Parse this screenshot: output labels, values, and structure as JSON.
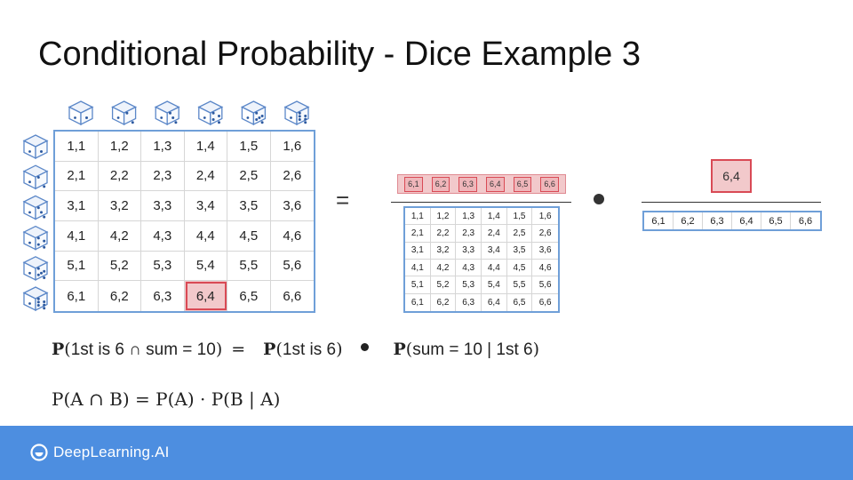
{
  "title": "Conditional Probability - Dice Example 3",
  "grid": {
    "rows": [
      [
        "1,1",
        "1,2",
        "1,3",
        "1,4",
        "1,5",
        "1,6"
      ],
      [
        "2,1",
        "2,2",
        "2,3",
        "2,4",
        "2,5",
        "2,6"
      ],
      [
        "3,1",
        "3,2",
        "3,3",
        "3,4",
        "3,5",
        "3,6"
      ],
      [
        "4,1",
        "4,2",
        "4,3",
        "4,4",
        "4,5",
        "4,6"
      ],
      [
        "5,1",
        "5,2",
        "5,3",
        "5,4",
        "5,5",
        "5,6"
      ],
      [
        "6,1",
        "6,2",
        "6,3",
        "6,4",
        "6,5",
        "6,6"
      ]
    ],
    "highlighted": "6,4",
    "die_faces": [
      1,
      2,
      3,
      4,
      5,
      6
    ]
  },
  "equation": {
    "equals_sign": "=",
    "numerator_row": [
      "6,1",
      "6,2",
      "6,3",
      "6,4",
      "6,5",
      "6,6"
    ],
    "single_outcome": "6,4",
    "denominator_row": [
      "6,1",
      "6,2",
      "6,3",
      "6,4",
      "6,5",
      "6,6"
    ]
  },
  "formula1": {
    "lhs_arg": "1st is 6 ∩ sum = 10",
    "equals": "=",
    "term1_arg": "1st is 6",
    "term2_arg": "sum = 10 | 1st 6"
  },
  "formula2": {
    "text": "P(A ∩ B) = P(A) · P(B | A)"
  },
  "footer": {
    "brand": "DeepLearning.AI"
  },
  "colors": {
    "grid_border": "#6f9fd8",
    "highlight_fill": "#f2c9cb",
    "highlight_border": "#d94a55",
    "footer": "#4d8ee0"
  }
}
